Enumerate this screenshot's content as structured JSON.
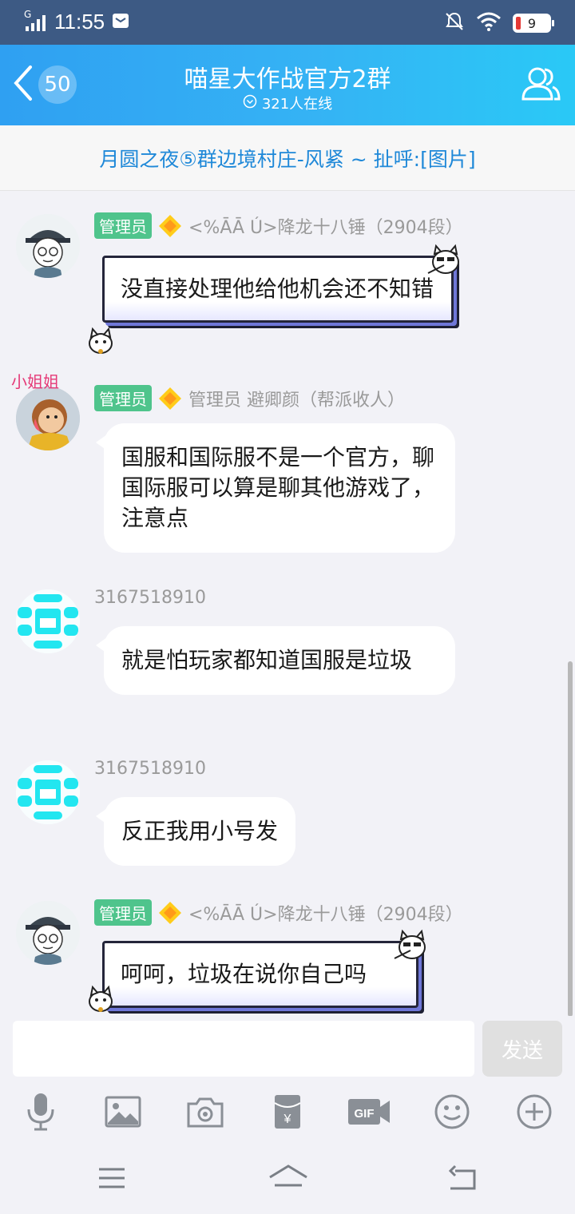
{
  "status": {
    "time": "11:55",
    "network": "G",
    "battery": "9"
  },
  "header": {
    "back_count": "50",
    "title": "喵星大作战官方2群",
    "online": "321人在线"
  },
  "notice": {
    "text": "月圆之夜⑤群边境村庄-风紧 ~ 扯呼:[图片]"
  },
  "messages": [
    {
      "badge": "管理员",
      "sender": "<%ĀĀ Ú>降龙十八锤（2904段）",
      "text": "没直接处理他给他机会还不知错"
    },
    {
      "badge": "管理员",
      "sender": "管理员 避卿颜（帮派收人）",
      "avatar_text": "小姐姐",
      "text": "国服和国际服不是一个官方，聊国际服可以算是聊其他游戏了，注意点"
    },
    {
      "sender": "3167518910",
      "text": "就是怕玩家都知道国服是垃圾"
    },
    {
      "sender": "3167518910",
      "text": "反正我用小号发"
    },
    {
      "badge": "管理员",
      "sender": "<%ĀĀ Ú>降龙十八锤（2904段）",
      "text": "呵呵，垃圾在说你自己吗"
    }
  ],
  "input": {
    "placeholder": "",
    "send_label": "发送"
  },
  "toolbar": {
    "icons": [
      "microphone-icon",
      "image-icon",
      "camera-icon",
      "red-packet-icon",
      "gif-icon",
      "emoji-icon",
      "plus-icon"
    ]
  },
  "colors": {
    "header_gradient_start": "#2fa0f2",
    "header_gradient_end": "#2ac9f6",
    "status_bar": "#3d5a84",
    "notice_text": "#1e88d8",
    "admin_badge": "#4fc48c"
  }
}
